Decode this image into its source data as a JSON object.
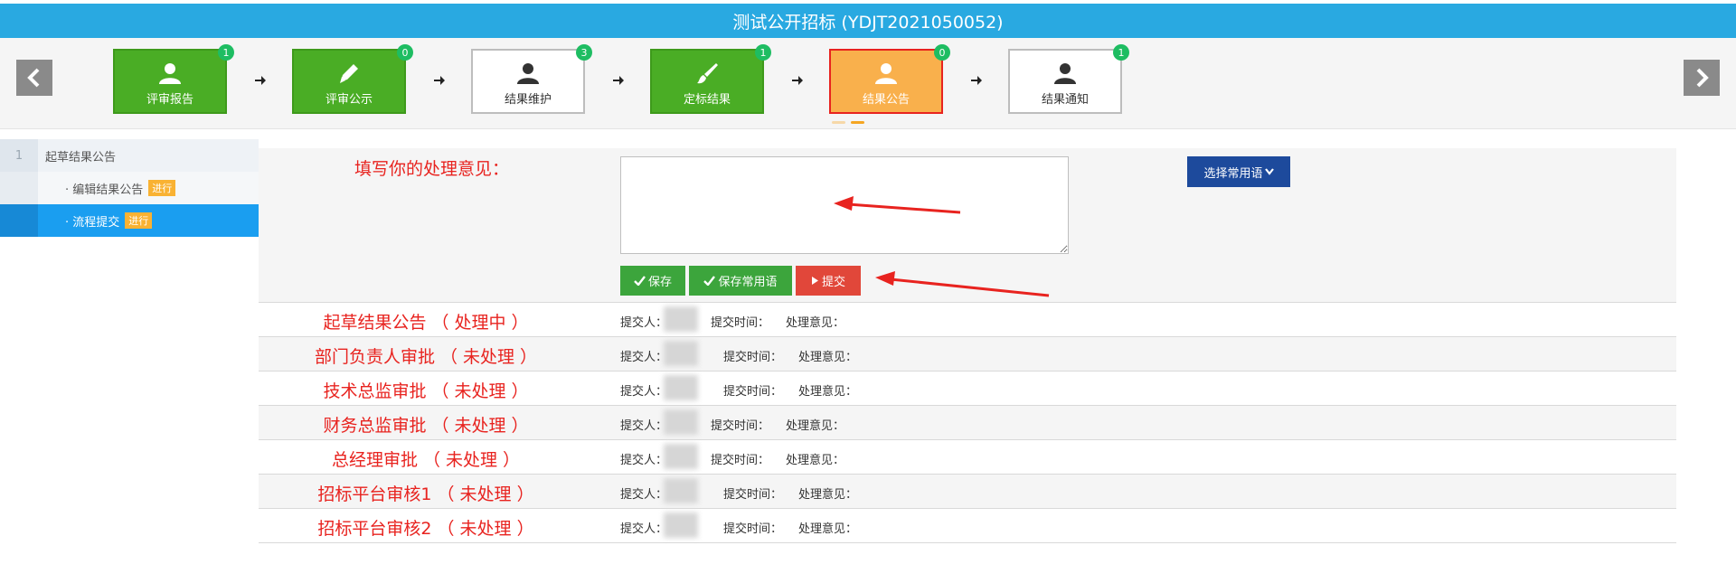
{
  "window": {
    "title": "测试公开招标 (YDJT2021050052)"
  },
  "nav": {
    "prev_glyph": "‹",
    "next_glyph": "›"
  },
  "steps": [
    {
      "label": "评审报告",
      "count": "1",
      "icon": "user-icon",
      "style": "green"
    },
    {
      "label": "评审公示",
      "count": "0",
      "icon": "pencil-icon",
      "style": "green"
    },
    {
      "label": "结果维护",
      "count": "3",
      "icon": "user-icon",
      "style": "white"
    },
    {
      "label": "定标结果",
      "count": "1",
      "icon": "brush-icon",
      "style": "green"
    },
    {
      "label": "结果公告",
      "count": "0",
      "icon": "user-icon",
      "style": "active"
    },
    {
      "label": "结果通知",
      "count": "1",
      "icon": "user-icon",
      "style": "white"
    }
  ],
  "sidebar": {
    "section_number": "1",
    "section_title": "起草结果公告",
    "items": [
      {
        "label": "· 编辑结果公告",
        "tag": "进行",
        "selected": false
      },
      {
        "label": "· 流程提交",
        "tag": "进行",
        "selected": true
      }
    ]
  },
  "opinion": {
    "label": "填写你的处理意见：",
    "text_value": "",
    "phrase_button": "选择常用语",
    "save_button": "保存",
    "save_phrase_button": "保存常用语",
    "submit_button": "提交"
  },
  "flow_fields": {
    "submitter_label": "提交人：",
    "time_label": "提交时间：",
    "opinion_label": "处理意见："
  },
  "flow": [
    {
      "stage": "起草结果公告 （ 处理中 ）"
    },
    {
      "stage": "部门负责人审批 （ 未处理 ）"
    },
    {
      "stage": "技术总监审批 （ 未处理 ）"
    },
    {
      "stage": "财务总监审批 （ 未处理 ）"
    },
    {
      "stage": "总经理审批 （ 未处理 ）"
    },
    {
      "stage": "招标平台审核1 （ 未处理 ）"
    },
    {
      "stage": "招标平台审核2 （ 未处理 ）"
    }
  ],
  "colors": {
    "title_bar": "#29a9e1",
    "step_green": "#4aad25",
    "step_active": "#f9b04c",
    "badge": "#1ebd62",
    "label_red": "#e8231f",
    "submit_red": "#e1473a",
    "phrase_blue": "#1d4a9c",
    "sidebar_selected": "#1a9ef0"
  }
}
